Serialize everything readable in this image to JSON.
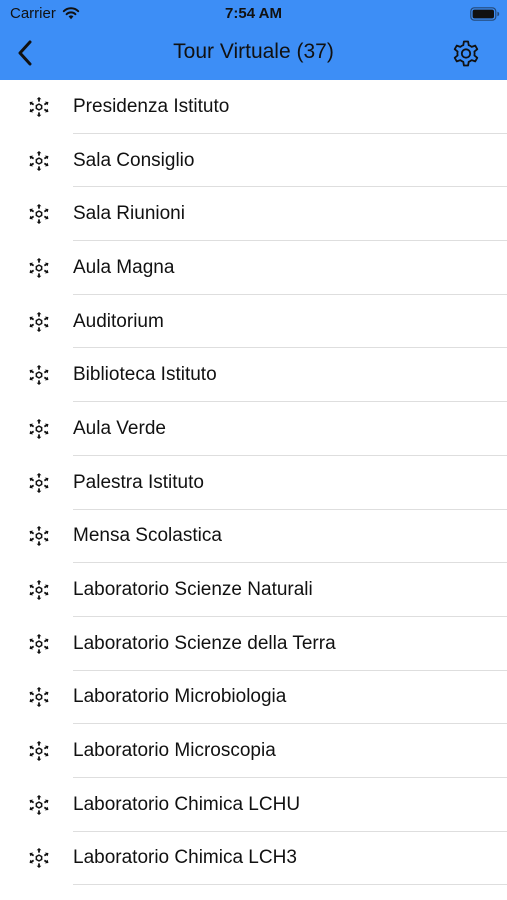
{
  "status_bar": {
    "carrier": "Carrier",
    "time": "7:54 AM"
  },
  "nav": {
    "title": "Tour Virtuale (37)",
    "back_icon": "chevron-left-icon",
    "settings_icon": "gear-icon"
  },
  "colors": {
    "header_background": "#3d8ef6",
    "separator": "#dedede"
  },
  "list": {
    "row_icon": "panorama-360-icon",
    "items": [
      {
        "label": "Presidenza Istituto"
      },
      {
        "label": "Sala Consiglio"
      },
      {
        "label": "Sala Riunioni"
      },
      {
        "label": "Aula Magna"
      },
      {
        "label": "Auditorium"
      },
      {
        "label": "Biblioteca Istituto"
      },
      {
        "label": "Aula Verde"
      },
      {
        "label": "Palestra Istituto"
      },
      {
        "label": "Mensa Scolastica"
      },
      {
        "label": "Laboratorio Scienze Naturali"
      },
      {
        "label": "Laboratorio Scienze della Terra"
      },
      {
        "label": "Laboratorio Microbiologia"
      },
      {
        "label": "Laboratorio Microscopia"
      },
      {
        "label": "Laboratorio Chimica LCHU"
      },
      {
        "label": "Laboratorio Chimica LCH3"
      }
    ]
  }
}
